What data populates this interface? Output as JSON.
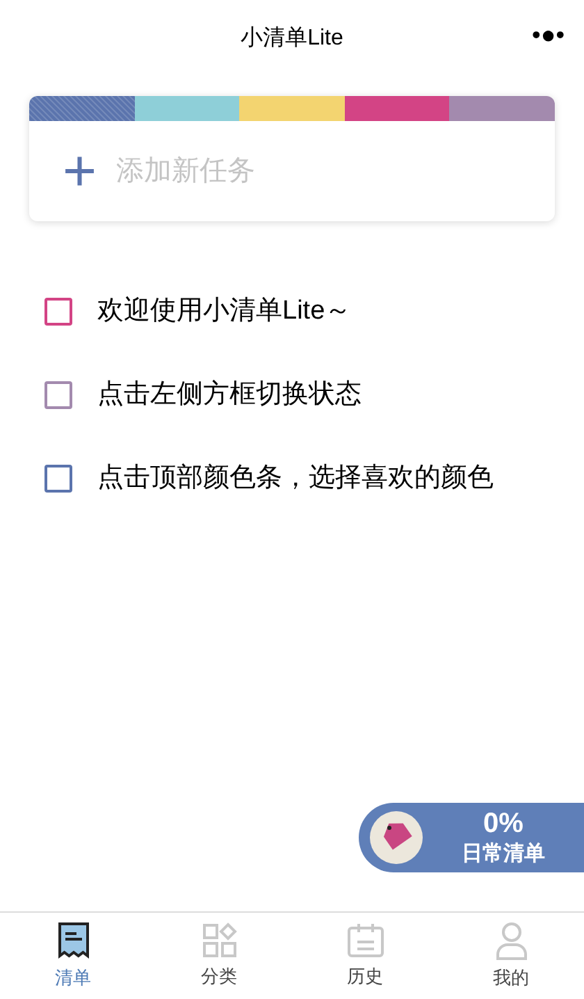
{
  "title": "小清单Lite",
  "more": "•●•",
  "color_bar": [
    {
      "color": "#5b74ad",
      "selected": true
    },
    {
      "color": "#8ecfd8",
      "selected": false
    },
    {
      "color": "#f3d470",
      "selected": false
    },
    {
      "color": "#d34485",
      "selected": false
    },
    {
      "color": "#a38aae",
      "selected": false
    }
  ],
  "add_task": {
    "icon": "+",
    "placeholder": "添加新任务"
  },
  "tasks": [
    {
      "text": "欢迎使用小清单Lite～",
      "color": "#d34485",
      "checked": false
    },
    {
      "text": "点击左侧方框切换状态",
      "color": "#a38aae",
      "checked": false
    },
    {
      "text": "点击顶部颜色条，选择喜欢的颜色",
      "color": "#5b74ad",
      "checked": false
    }
  ],
  "progress_badge": {
    "percent": "0%",
    "list_name": "日常清单"
  },
  "tabs": [
    {
      "label": "清单",
      "kind": "list",
      "selected": true
    },
    {
      "label": "分类",
      "kind": "category",
      "selected": false
    },
    {
      "label": "历史",
      "kind": "history",
      "selected": false
    },
    {
      "label": "我的",
      "kind": "profile",
      "selected": false
    }
  ]
}
